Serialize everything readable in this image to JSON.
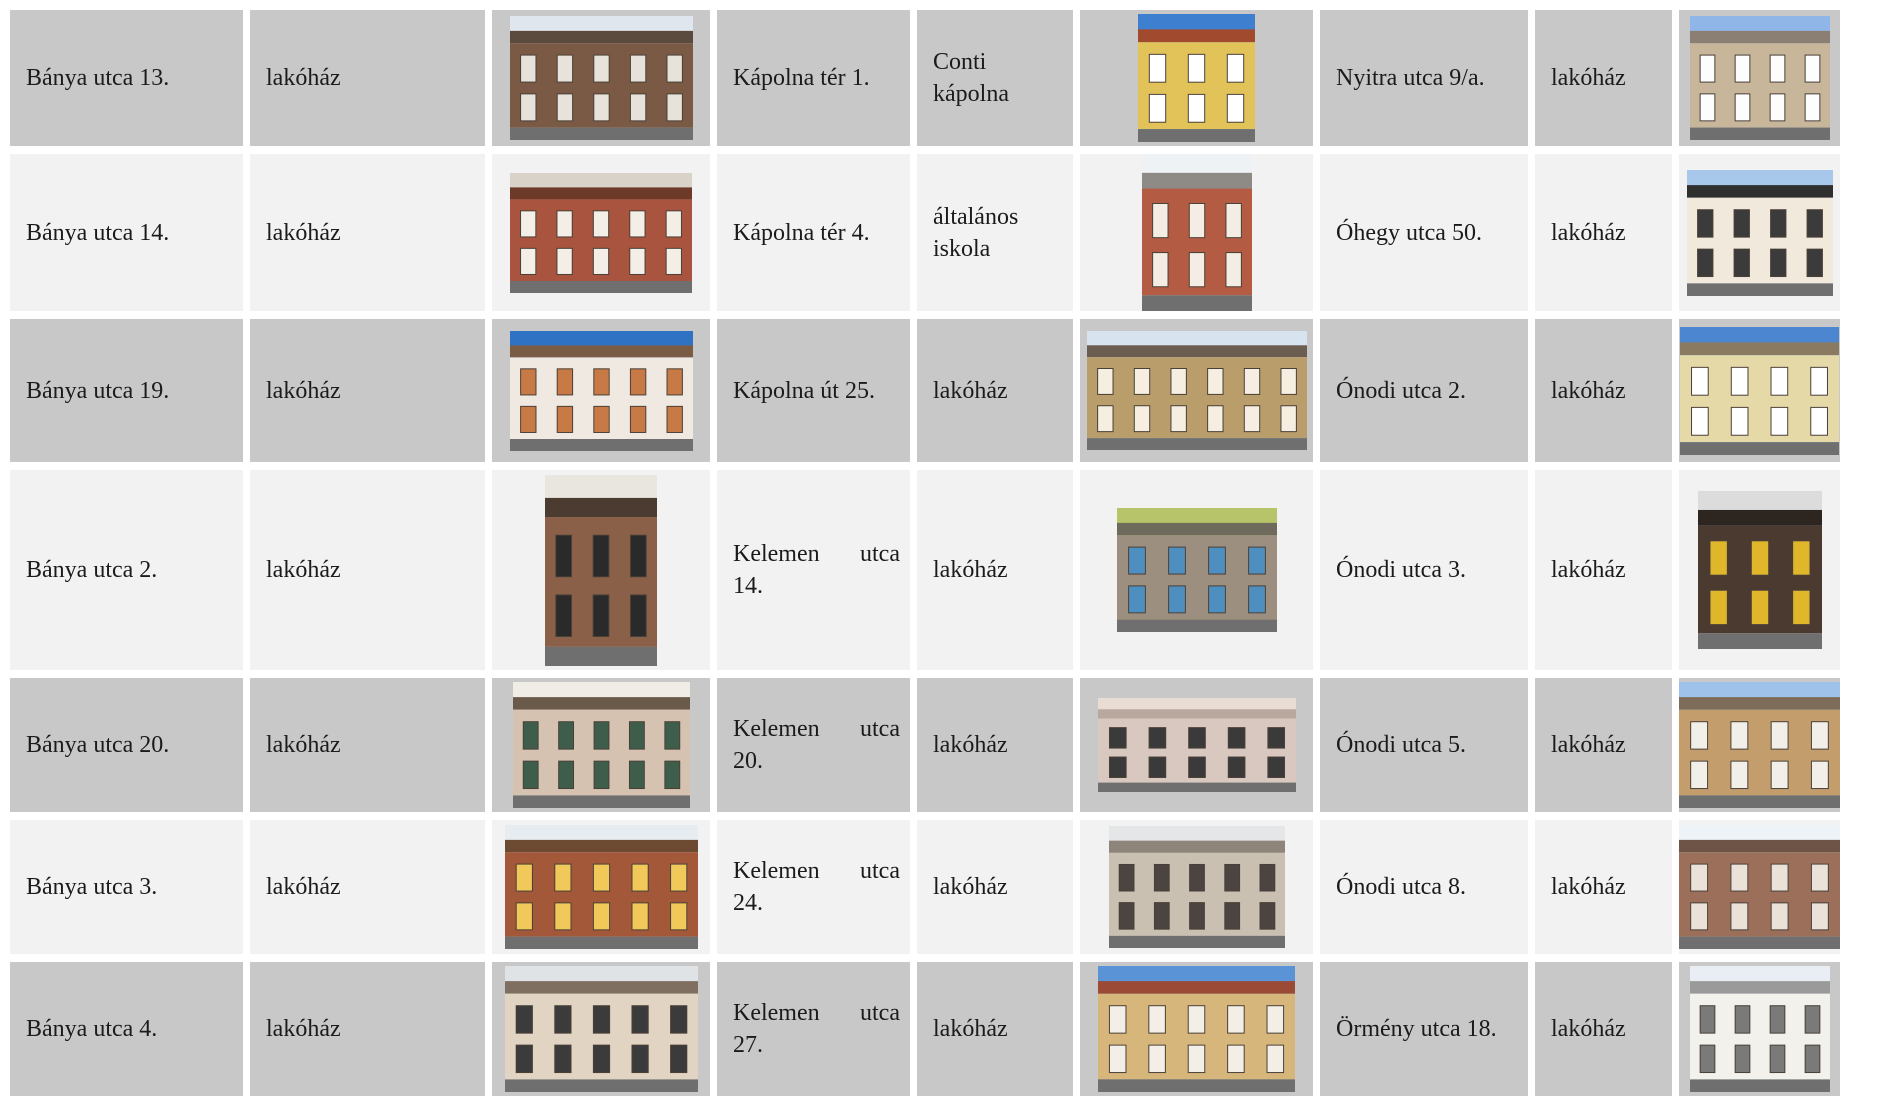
{
  "rows": [
    {
      "c1": {
        "address": "Bánya utca 13.",
        "type": "lakóház",
        "photo": {
          "icon": "photo-icon",
          "sky": "#dfe6ee",
          "wall": "#7a5a45",
          "roof": "#5b4a3e",
          "window": "#e8e3da"
        }
      },
      "c2": {
        "address": "Kápolna tér 1.",
        "type": "Conti kápolna",
        "photo": {
          "icon": "photo-icon",
          "sky": "#3f7fd0",
          "wall": "#e2c35a",
          "roof": "#a14a2d",
          "window": "#ffffff"
        }
      },
      "c3": {
        "address": "Nyitra utca 9/a.",
        "type": "lakóház",
        "photo": {
          "icon": "photo-icon",
          "sky": "#8fb6e6",
          "wall": "#c8b69a",
          "roof": "#8b7f73",
          "window": "#fdfdfd"
        }
      }
    },
    {
      "c1": {
        "address": "Bánya utca 14.",
        "type": "lakóház",
        "photo": {
          "icon": "photo-icon",
          "sky": "#d8d2c8",
          "wall": "#a8543e",
          "roof": "#6d3a2a",
          "window": "#f4efe6"
        }
      },
      "c2": {
        "address": "Kápolna tér 4.",
        "type": "általános iskola",
        "photo": {
          "icon": "photo-icon",
          "sky": "#eef2f5",
          "wall": "#b45b43",
          "roof": "#8e8a85",
          "window": "#f3ede4"
        }
      },
      "c3": {
        "address": "Óhegy utca 50.",
        "type": "lakóház",
        "photo": {
          "icon": "photo-icon",
          "sky": "#a7c8ea",
          "wall": "#f1e9dc",
          "roof": "#2f2f2f",
          "window": "#3b3b3b"
        }
      }
    },
    {
      "c1": {
        "address": "Bánya utca 19.",
        "type": "lakóház",
        "photo": {
          "icon": "photo-icon",
          "sky": "#2f72c4",
          "wall": "#efe9e1",
          "roof": "#7a5b43",
          "window": "#c77a45"
        }
      },
      "c2": {
        "address": "Kápolna út 25.",
        "type": "lakóház",
        "photo": {
          "icon": "photo-icon",
          "sky": "#d7e3ee",
          "wall": "#b99d6a",
          "roof": "#6b5d50",
          "window": "#f6efe1"
        }
      },
      "c3": {
        "address": "Ónodi utca 2.",
        "type": "lakóház",
        "photo": {
          "icon": "photo-icon",
          "sky": "#4d86d0",
          "wall": "#e6d9a8",
          "roof": "#8a7a62",
          "window": "#ffffff"
        }
      }
    },
    {
      "c1": {
        "address": "Bánya utca 2.",
        "type": "lakóház",
        "photo": {
          "icon": "photo-icon",
          "sky": "#e9e5df",
          "wall": "#8a6048",
          "roof": "#4b3b30",
          "window": "#2a2a2a"
        }
      },
      "c2": {
        "address": "Kelemen utca 14.",
        "type": "lakóház",
        "photo": {
          "icon": "photo-icon",
          "sky": "#b8c46a",
          "wall": "#9d8f80",
          "roof": "#6e6a5c",
          "window": "#4f8fbf"
        }
      },
      "c3": {
        "address": "Ónodi utca 3.",
        "type": "lakóház",
        "photo": {
          "icon": "photo-icon",
          "sky": "#dcdcdc",
          "wall": "#4a3a30",
          "roof": "#2c2520",
          "window": "#e0b72a"
        }
      }
    },
    {
      "c1": {
        "address": "Bánya utca 20.",
        "type": "lakóház",
        "photo": {
          "icon": "photo-icon",
          "sky": "#f0ede6",
          "wall": "#d6c2b0",
          "roof": "#6a5a4a",
          "window": "#3e5e4b"
        }
      },
      "c2": {
        "address": "Kelemen utca 20.",
        "type": "lakóház",
        "photo": {
          "icon": "photo-icon",
          "sky": "#e8dcd3",
          "wall": "#d9c8bf",
          "roof": "#b9a89d",
          "window": "#3a3a3a"
        }
      },
      "c3": {
        "address": "Ónodi utca 5.",
        "type": "lakóház",
        "photo": {
          "icon": "photo-icon",
          "sky": "#9ec2ea",
          "wall": "#c49d6c",
          "roof": "#7d6c5a",
          "window": "#f2efe8"
        }
      }
    },
    {
      "c1": {
        "address": "Bánya utca 3.",
        "type": "lakóház",
        "photo": {
          "icon": "photo-icon",
          "sky": "#e7ecf0",
          "wall": "#a4583a",
          "roof": "#6d4b33",
          "window": "#f0c95a"
        }
      },
      "c2": {
        "address": "Kelemen utca 24.",
        "type": "lakóház",
        "photo": {
          "icon": "photo-icon",
          "sky": "#e4e6e8",
          "wall": "#c9c0b2",
          "roof": "#8d857a",
          "window": "#4b4440"
        }
      },
      "c3": {
        "address": "Ónodi utca 8.",
        "type": "lakóház",
        "photo": {
          "icon": "photo-icon",
          "sky": "#eef3f7",
          "wall": "#9c6f5a",
          "roof": "#6e5446",
          "window": "#eae2d8"
        }
      }
    },
    {
      "c1": {
        "address": "Bánya utca 4.",
        "type": "lakóház",
        "photo": {
          "icon": "photo-icon",
          "sky": "#dfe3e6",
          "wall": "#e2d4c3",
          "roof": "#7e6f60",
          "window": "#3b3b3b"
        }
      },
      "c2": {
        "address": "Kelemen utca 27.",
        "type": "lakóház",
        "photo": {
          "icon": "photo-icon",
          "sky": "#5a93d6",
          "wall": "#d7b67c",
          "roof": "#9b4a35",
          "window": "#f4efe6"
        }
      },
      "c3": {
        "address": "Örmény utca 18.",
        "type": "lakóház",
        "photo": {
          "icon": "photo-icon",
          "sky": "#e8eef3",
          "wall": "#f3f1ec",
          "roof": "#9a9a9a",
          "window": "#7a7a7a"
        }
      }
    }
  ]
}
